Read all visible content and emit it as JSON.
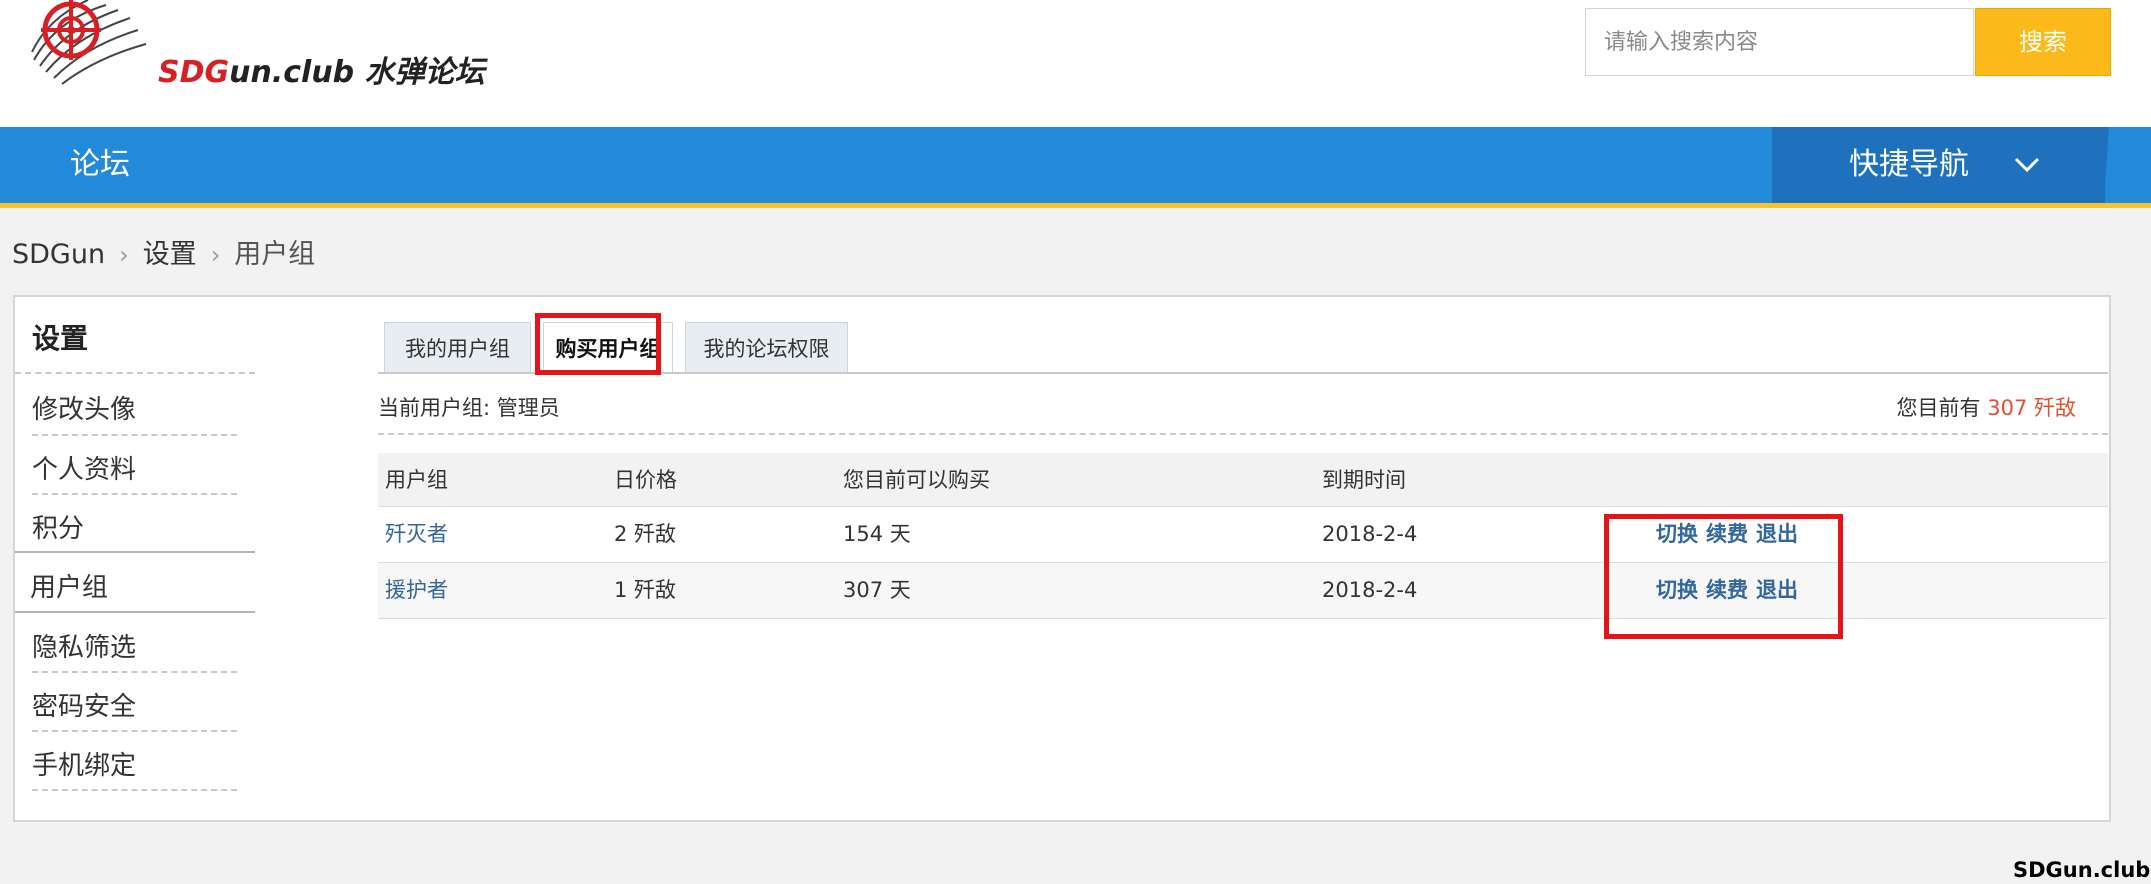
{
  "header": {
    "logo_text": "SDGun.club 水弹论坛",
    "search_placeholder": "请输入搜索内容",
    "search_button": "搜索"
  },
  "nav": {
    "home": "论坛",
    "quick_nav": "快捷导航"
  },
  "breadcrumb": [
    "SDGun",
    "设置",
    "用户组"
  ],
  "sidebar": {
    "title": "设置",
    "items": [
      "修改头像",
      "个人资料",
      "积分",
      "用户组",
      "隐私筛选",
      "密码安全",
      "手机绑定"
    ],
    "active": "用户组"
  },
  "tabs": [
    "我的用户组",
    "购买用户组",
    "我的论坛权限"
  ],
  "active_tab": "购买用户组",
  "info": {
    "current_group_label": "当前用户组: 管理员",
    "balance_prefix": "您目前有",
    "balance_amount": "307 歼敌"
  },
  "table": {
    "headers": [
      "用户组",
      "日价格",
      "您目前可以购买",
      "到期时间"
    ],
    "rows": [
      {
        "group": "歼灭者",
        "price": "2 歼敌",
        "can_buy": "154 天",
        "expires": "2018-2-4",
        "actions": [
          "切换",
          "续费",
          "退出"
        ]
      },
      {
        "group": "援护者",
        "price": "1 歼敌",
        "can_buy": "307 天",
        "expires": "2018-2-4",
        "actions": [
          "切换",
          "续费",
          "退出"
        ]
      }
    ]
  },
  "watermark": "SDGun.club",
  "colors": {
    "nav_blue": "#2389d9",
    "quicknav_blue": "#1e72bd",
    "accent_yellow": "#fbb91a",
    "highlight_red": "#e4141b",
    "link_blue": "#336699",
    "amount_orange": "#e0512f"
  }
}
